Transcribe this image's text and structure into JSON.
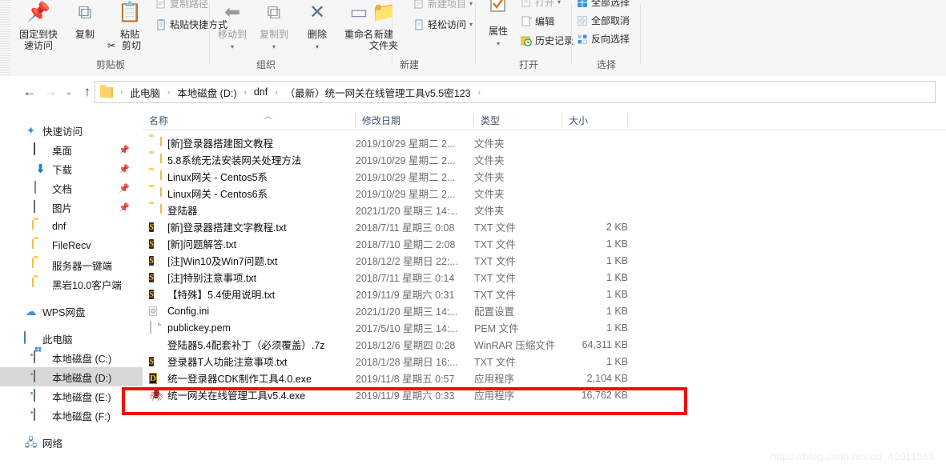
{
  "ribbon": {
    "groups": [
      {
        "name": "clipboard",
        "label": "剪贴板",
        "big_buttons": [
          {
            "caption1": "固定到快",
            "caption2": "速访问",
            "icon": "pin-icon"
          },
          {
            "caption1": "复制",
            "caption2": "",
            "icon": "copy-icon"
          },
          {
            "caption1": "粘贴",
            "caption2": "",
            "icon": "paste-icon"
          }
        ],
        "small_buttons": [
          {
            "label": "复制路径",
            "icon": "copy-path-icon"
          },
          {
            "label": "粘贴快捷方式",
            "icon": "paste-shortcut-icon"
          },
          {
            "label": "剪切",
            "icon": "scissors-icon"
          }
        ]
      },
      {
        "name": "organize",
        "label": "组织",
        "big_buttons": [
          {
            "caption1": "移动到",
            "caption2": "",
            "icon": "move-to-icon",
            "dim": true,
            "caret": true
          },
          {
            "caption1": "复制到",
            "caption2": "",
            "icon": "copy-to-icon",
            "dim": true,
            "caret": true
          },
          {
            "caption1": "删除",
            "caption2": "",
            "icon": "delete-icon",
            "caret": true
          },
          {
            "caption1": "重命名",
            "caption2": "",
            "icon": "rename-icon"
          }
        ],
        "small_buttons": []
      },
      {
        "name": "new",
        "label": "新建",
        "big_buttons": [
          {
            "caption1": "新建",
            "caption2": "文件夹",
            "icon": "new-folder-icon"
          }
        ],
        "small_buttons": [
          {
            "label": "新建项目",
            "icon": "new-item-icon",
            "caret": true
          },
          {
            "label": "轻松访问",
            "icon": "easy-access-icon",
            "caret": true
          }
        ]
      },
      {
        "name": "open",
        "label": "打开",
        "big_buttons": [
          {
            "caption1": "属性",
            "caption2": "",
            "icon": "properties-icon",
            "caret": true
          }
        ],
        "small_buttons": [
          {
            "label": "打开",
            "icon": "open-icon",
            "dim": true,
            "caret": true
          },
          {
            "label": "编辑",
            "icon": "edit-icon"
          },
          {
            "label": "历史记录",
            "icon": "history-icon"
          }
        ]
      },
      {
        "name": "select",
        "label": "选择",
        "big_buttons": [],
        "small_buttons": [
          {
            "label": "全部选择",
            "icon": "select-all-icon"
          },
          {
            "label": "全部取消",
            "icon": "select-none-icon"
          },
          {
            "label": "反向选择",
            "icon": "invert-selection-icon"
          }
        ]
      }
    ]
  },
  "addressbar": {
    "back_icon": "back-arrow-icon",
    "forward_icon": "forward-arrow-icon",
    "recent_icon": "chevron-down-icon",
    "up_icon": "up-arrow-icon",
    "folder_icon": "folder-icon",
    "crumbs": [
      "此电脑",
      "本地磁盘 (D:)",
      "dnf",
      "（最新）统一网关在线管理工具v5.5密123"
    ],
    "separator": "›"
  },
  "sidebar": {
    "sections": [
      {
        "name": "quick-access",
        "header": {
          "label": "快速访问",
          "icon": "star-pin-icon"
        },
        "items": [
          {
            "label": "桌面",
            "icon": "desktop-icon",
            "pinned": true
          },
          {
            "label": "下载",
            "icon": "download-icon",
            "pinned": true
          },
          {
            "label": "文档",
            "icon": "documents-icon",
            "pinned": true
          },
          {
            "label": "图片",
            "icon": "pictures-icon",
            "pinned": true
          },
          {
            "label": "dnf",
            "icon": "folder-icon",
            "pinned": false
          },
          {
            "label": "FileRecv",
            "icon": "folder-icon",
            "pinned": false
          },
          {
            "label": "服务器一键端",
            "icon": "folder-icon",
            "pinned": false
          },
          {
            "label": "黑岩10.0客户端",
            "icon": "folder-icon",
            "pinned": false
          }
        ]
      },
      {
        "name": "wps-cloud",
        "header": {
          "label": "WPS网盘",
          "icon": "cloud-icon"
        },
        "items": []
      },
      {
        "name": "this-pc",
        "header": {
          "label": "此电脑",
          "icon": "this-pc-icon"
        },
        "items": [
          {
            "label": "本地磁盘 (C:)",
            "icon": "windows-drive-icon",
            "selected": false
          },
          {
            "label": "本地磁盘 (D:)",
            "icon": "drive-icon",
            "selected": true
          },
          {
            "label": "本地磁盘 (E:)",
            "icon": "drive-icon",
            "selected": false
          },
          {
            "label": "本地磁盘 (F:)",
            "icon": "drive-icon",
            "selected": false
          }
        ]
      },
      {
        "name": "network",
        "header": {
          "label": "网络",
          "icon": "network-icon"
        },
        "items": []
      }
    ]
  },
  "filelist": {
    "columns": [
      {
        "label": "名称",
        "sorted": true,
        "sort_dir": "asc"
      },
      {
        "label": "修改日期",
        "sorted": false
      },
      {
        "label": "类型",
        "sorted": false
      },
      {
        "label": "大小",
        "sorted": false
      }
    ],
    "rows": [
      {
        "name": "[新]登录器搭建图文教程",
        "date": "2019/10/29 星期二 2...",
        "type": "文件夹",
        "size": "",
        "icon": "folder-icon"
      },
      {
        "name": "5.8系统无法安装网关处理方法",
        "date": "2019/10/29 星期二 2...",
        "type": "文件夹",
        "size": "",
        "icon": "folder-icon"
      },
      {
        "name": "Linux网关 - Centos5系",
        "date": "2019/10/29 星期二 2...",
        "type": "文件夹",
        "size": "",
        "icon": "folder-icon"
      },
      {
        "name": "Linux网关 - Centos6系",
        "date": "2019/10/29 星期二 2...",
        "type": "文件夹",
        "size": "",
        "icon": "folder-icon"
      },
      {
        "name": "登陆器",
        "date": "2021/1/20 星期三 14:...",
        "type": "文件夹",
        "size": "",
        "icon": "folder-icon"
      },
      {
        "name": "[新]登录器搭建文字教程.txt",
        "date": "2018/7/11 星期三 0:08",
        "type": "TXT 文件",
        "size": "2 KB",
        "icon": "txt-file-icon"
      },
      {
        "name": "[新]问题解答.txt",
        "date": "2018/7/10 星期二 2:08",
        "type": "TXT 文件",
        "size": "1 KB",
        "icon": "txt-file-icon"
      },
      {
        "name": "[注]Win10及Win7问题.txt",
        "date": "2018/12/2 星期日 22:...",
        "type": "TXT 文件",
        "size": "1 KB",
        "icon": "txt-file-icon"
      },
      {
        "name": "[注]特别注意事项.txt",
        "date": "2018/7/11 星期三 0:14",
        "type": "TXT 文件",
        "size": "1 KB",
        "icon": "txt-file-icon"
      },
      {
        "name": "【特殊】5.4使用说明.txt",
        "date": "2019/11/9 星期六 0:31",
        "type": "TXT 文件",
        "size": "1 KB",
        "icon": "txt-file-icon"
      },
      {
        "name": "Config.ini",
        "date": "2021/1/20 星期三 14:...",
        "type": "配置设置",
        "size": "1 KB",
        "icon": "ini-file-icon"
      },
      {
        "name": "publickey.pem",
        "date": "2017/5/10 星期三 14:...",
        "type": "PEM 文件",
        "size": "1 KB",
        "icon": "pem-file-icon"
      },
      {
        "name": "登陆器5.4配套补丁（必须覆盖）.7z",
        "date": "2018/12/6 星期四 0:28",
        "type": "WinRAR 压缩文件",
        "size": "64,311 KB",
        "icon": "archive-icon"
      },
      {
        "name": "登录器T人功能注意事项.txt",
        "date": "2018/1/28 星期日 16:...",
        "type": "TXT 文件",
        "size": "1 KB",
        "icon": "txt-file-icon"
      },
      {
        "name": "统一登录器CDK制作工具4.0.exe",
        "date": "2019/11/8 星期五 0:57",
        "type": "应用程序",
        "size": "2,104 KB",
        "icon": "exe-dungeon-icon"
      },
      {
        "name": "统一网关在线管理工具v5.4.exe",
        "date": "2019/11/9 星期六 0:33",
        "type": "应用程序",
        "size": "16,762 KB",
        "icon": "exe-spider-icon",
        "highlighted": true
      }
    ]
  },
  "annotation": {
    "highlight_color": "#f20d0d",
    "target_row": "统一网关在线管理工具v5.4.exe"
  },
  "watermark": {
    "text": "https://blog.csdn.net/qq_42011565"
  }
}
